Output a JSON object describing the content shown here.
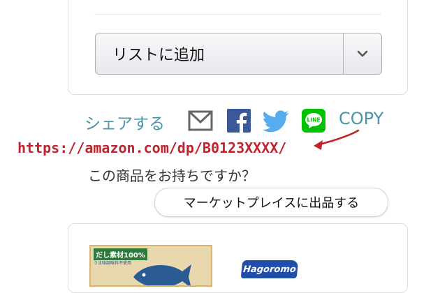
{
  "add_to_list": {
    "label": "リストに追加"
  },
  "share": {
    "label": "シェアする",
    "copy_label": "COPY",
    "icons": [
      "mail-icon",
      "facebook-icon",
      "twitter-icon",
      "line-icon"
    ],
    "line_text": "LINE",
    "colors": {
      "facebook": "#3b5998",
      "twitter": "#55acee",
      "line": "#00c300",
      "mail": "#666666",
      "link": "#4a95a9"
    }
  },
  "annotation": {
    "url": "https://amazon.com/dp/B0123XXXX/",
    "color": "#c0232b"
  },
  "sell": {
    "question": "この商品をお持ちですか？",
    "button_label": "マーケットプレイスに出品する"
  },
  "product": {
    "badge": "だし素材100%",
    "badge_sub": "うま味調味料不使用",
    "brand": "Hagoromo"
  }
}
